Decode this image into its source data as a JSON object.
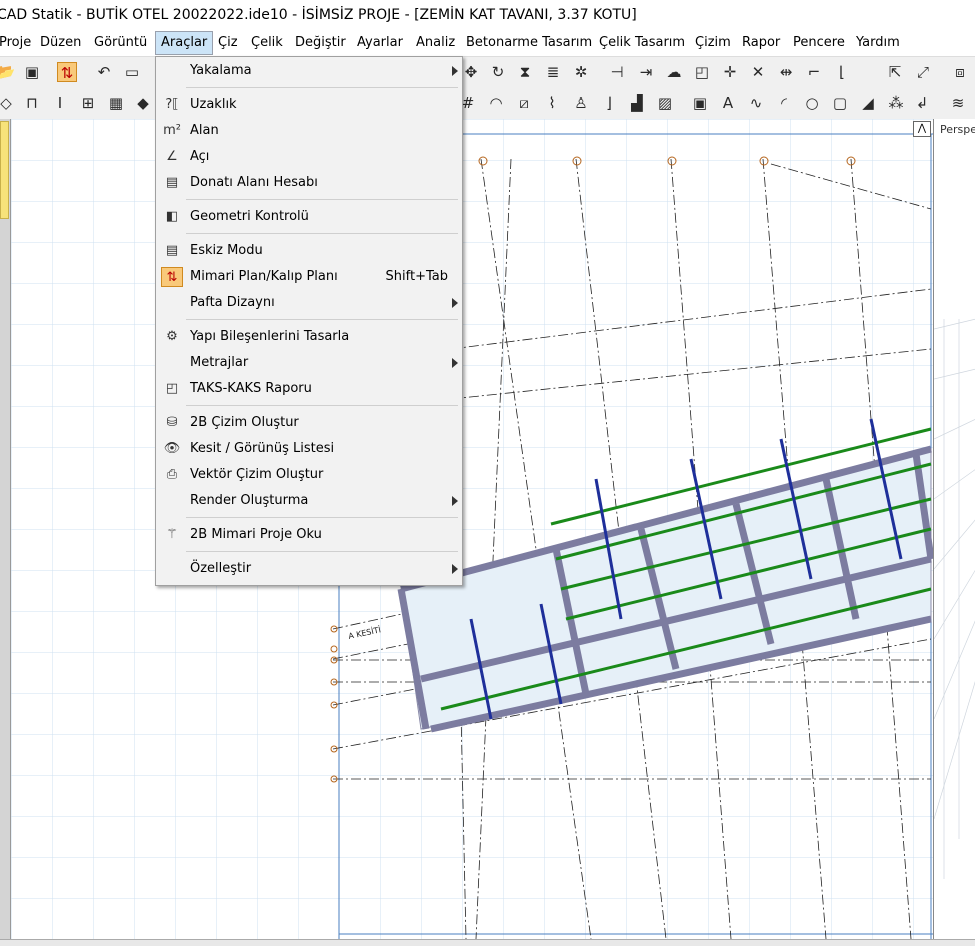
{
  "window": {
    "title": "CAD Statik - BUTİK OTEL 20022022.ide10 - İSİMSİZ PROJE - [ZEMİN KAT TAVANI,  3.37 KOTU]"
  },
  "menubar": {
    "items": [
      "Proje",
      "Düzen",
      "Görüntü",
      "Araçlar",
      "Çiz",
      "Çelik",
      "Değiştir",
      "Ayarlar",
      "Analiz",
      "Betonarme Tasarım",
      "Çelik Tasarım",
      "Çizim",
      "Rapor",
      "Pencere",
      "Yardım"
    ],
    "active": "Araçlar"
  },
  "dropdown": {
    "items": [
      {
        "label": "Yakalama",
        "icon": "none",
        "submenu": true
      },
      {
        "label": "Uzaklık",
        "icon": "distance-icon"
      },
      {
        "label": "Alan",
        "icon": "area-icon"
      },
      {
        "label": "Açı",
        "icon": "angle-icon"
      },
      {
        "label": "Donatı Alanı Hesabı",
        "icon": "rebar-area-icon"
      },
      {
        "label": "Geometri Kontrolü",
        "icon": "geometry-check-icon"
      },
      {
        "label": "Eskiz Modu",
        "icon": "sketch-icon"
      },
      {
        "label": "Mimari Plan/Kalıp Planı",
        "icon": "arch-plan-icon",
        "shortcut": "Shift+Tab"
      },
      {
        "label": "Pafta Dizaynı",
        "icon": "none",
        "submenu": true
      },
      {
        "label": "Yapı Bileşenlerini Tasarla",
        "icon": "design-components-icon"
      },
      {
        "label": "Metrajlar",
        "icon": "none",
        "submenu": true
      },
      {
        "label": "TAKS-KAKS Raporu",
        "icon": "taks-kaks-icon"
      },
      {
        "label": "2B Çizim Oluştur",
        "icon": "2d-drawing-icon"
      },
      {
        "label": "Kesit / Görünüş Listesi",
        "icon": "section-view-icon"
      },
      {
        "label": "Vektör Çizim Oluştur",
        "icon": "vector-drawing-icon"
      },
      {
        "label": "Render Oluşturma",
        "icon": "none",
        "submenu": true
      },
      {
        "label": "2B Mimari Proje Oku",
        "icon": "wand-icon"
      },
      {
        "label": "Özelleştir",
        "icon": "none",
        "submenu": true
      }
    ]
  },
  "right_panel": {
    "label": "Perspe"
  },
  "canvas": {
    "section_label": "A KESİTİ"
  }
}
